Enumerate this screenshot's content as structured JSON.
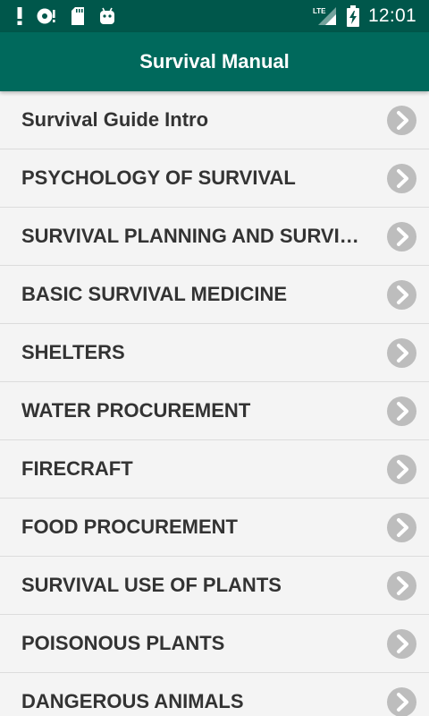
{
  "status_bar": {
    "time": "12:01",
    "network": "LTE",
    "icons": [
      "alert-icon",
      "sync-icon",
      "sd-card-icon",
      "android-debug-icon",
      "signal-icon",
      "battery-charging-icon"
    ]
  },
  "app_bar": {
    "title": "Survival Manual"
  },
  "chapters": [
    {
      "label": "Survival Guide Intro"
    },
    {
      "label": "PSYCHOLOGY OF SURVIVAL"
    },
    {
      "label": "SURVIVAL PLANNING AND SURVIVAL KITS"
    },
    {
      "label": "BASIC SURVIVAL MEDICINE"
    },
    {
      "label": "SHELTERS"
    },
    {
      "label": "WATER PROCUREMENT"
    },
    {
      "label": "FIRECRAFT"
    },
    {
      "label": "FOOD PROCUREMENT"
    },
    {
      "label": "SURVIVAL USE OF PLANTS"
    },
    {
      "label": "POISONOUS PLANTS"
    },
    {
      "label": "DANGEROUS ANIMALS"
    }
  ],
  "colors": {
    "status_bar": "#00574b",
    "app_bar": "#00695c",
    "list_background": "#f4f4f4",
    "chevron": "#bdbdbd"
  }
}
